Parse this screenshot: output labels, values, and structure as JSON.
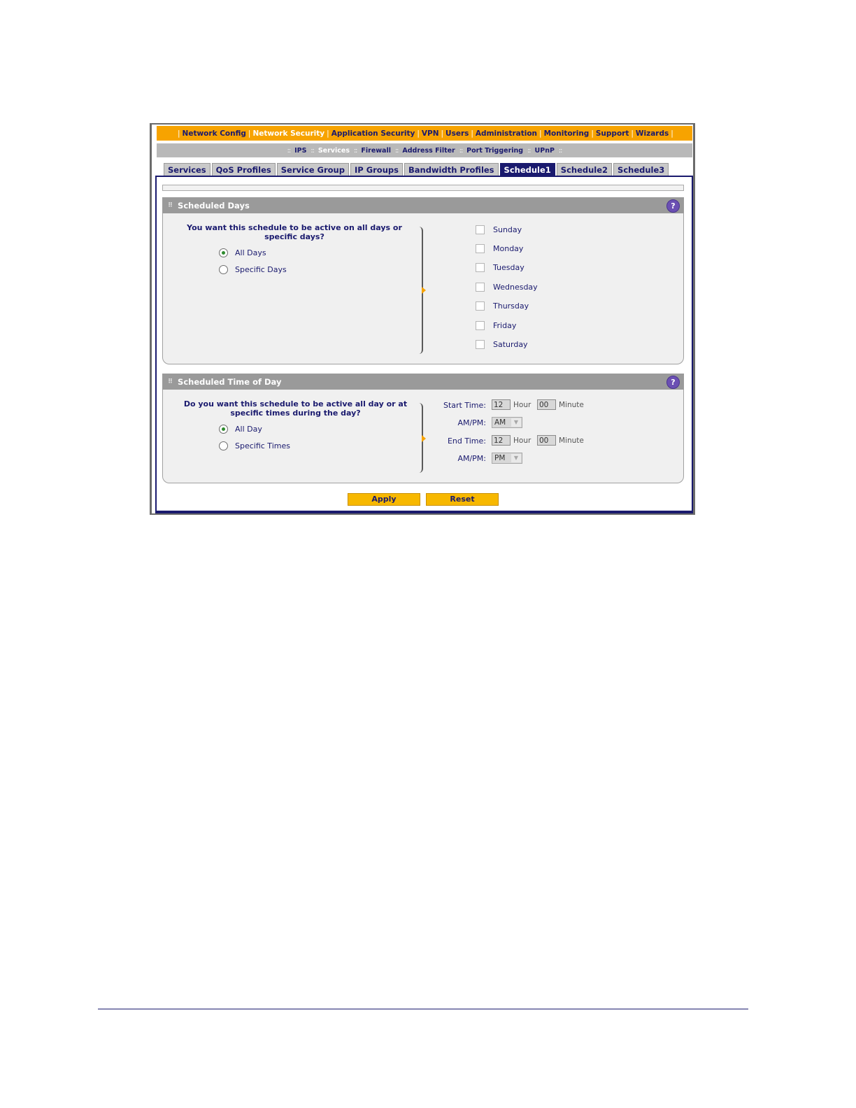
{
  "top_nav": [
    "Network Config",
    "Network Security",
    "Application Security",
    "VPN",
    "Users",
    "Administration",
    "Monitoring",
    "Support",
    "Wizards"
  ],
  "top_nav_active": "Network Security",
  "sub_nav": [
    "IPS",
    "Services",
    "Firewall",
    "Address Filter",
    "Port Triggering",
    "UPnP"
  ],
  "sub_nav_active": "Services",
  "tabs": [
    "Services",
    "QoS Profiles",
    "Service Group",
    "IP Groups",
    "Bandwidth Profiles",
    "Schedule1",
    "Schedule2",
    "Schedule3"
  ],
  "active_tab": "Schedule1",
  "scheduled_days": {
    "title": "Scheduled Days",
    "question": "You want this schedule to be active on all days or specific days?",
    "options": {
      "all": "All Days",
      "specific": "Specific Days"
    },
    "selected": "All Days",
    "days": [
      "Sunday",
      "Monday",
      "Tuesday",
      "Wednesday",
      "Thursday",
      "Friday",
      "Saturday"
    ]
  },
  "scheduled_time": {
    "title": "Scheduled Time of Day",
    "question": "Do you want this schedule to be active all day or at specific times during the day?",
    "options": {
      "all": "All Day",
      "specific": "Specific Times"
    },
    "selected": "All Day",
    "start_label": "Start Time:",
    "end_label": "End Time:",
    "ampm_label": "AM/PM:",
    "hour_unit": "Hour",
    "minute_unit": "Minute",
    "start_hour": "12",
    "start_minute": "00",
    "start_ampm": "AM",
    "end_hour": "12",
    "end_minute": "00",
    "end_ampm": "PM"
  },
  "buttons": {
    "apply": "Apply",
    "reset": "Reset"
  },
  "help_icon": "?",
  "icons": {
    "help": "help-icon",
    "grip": "grip-icon",
    "dropdown": "chevron-down-icon"
  },
  "colors": {
    "nav_orange": "#f7a300",
    "navy": "#1a1a6e",
    "button_yellow": "#f7b800",
    "help_purple": "#6b4fb3"
  }
}
